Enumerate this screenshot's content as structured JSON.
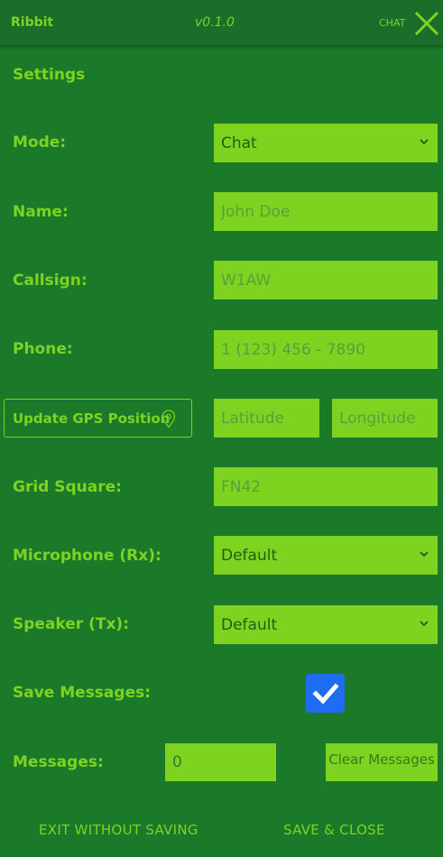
{
  "header": {
    "app_title": "Ribbit",
    "version": "v0.1.0",
    "chat_label": "CHAT",
    "close_icon": "close-icon"
  },
  "settings": {
    "section_title": "Settings",
    "mode": {
      "label": "Mode:",
      "value": "Chat"
    },
    "name": {
      "label": "Name:",
      "placeholder": "John Doe"
    },
    "callsign": {
      "label": "Callsign:",
      "placeholder": "W1AW"
    },
    "phone": {
      "label": "Phone:",
      "placeholder": "1 (123) 456 - 7890"
    },
    "gps": {
      "button_label": "Update GPS Position",
      "icon": "location-pin-icon",
      "latitude_placeholder": "Latitude",
      "longitude_placeholder": "Longitude"
    },
    "grid_square": {
      "label": "Grid Square:",
      "placeholder": "FN42"
    },
    "microphone": {
      "label": "Microphone (Rx):",
      "value": "Default"
    },
    "speaker": {
      "label": "Speaker (Tx):",
      "value": "Default"
    },
    "save_messages": {
      "label": "Save Messages:",
      "checked": true
    },
    "messages": {
      "label": "Messages:",
      "value": "0",
      "clear_label": "Clear Messages"
    }
  },
  "footer": {
    "exit_label": "EXIT WITHOUT SAVING",
    "save_label": "SAVE & CLOSE"
  },
  "colors": {
    "background": "#1a7a2a",
    "header": "#1a6e2a",
    "accent": "#7ed321",
    "checkbox": "#1e6cf0"
  }
}
